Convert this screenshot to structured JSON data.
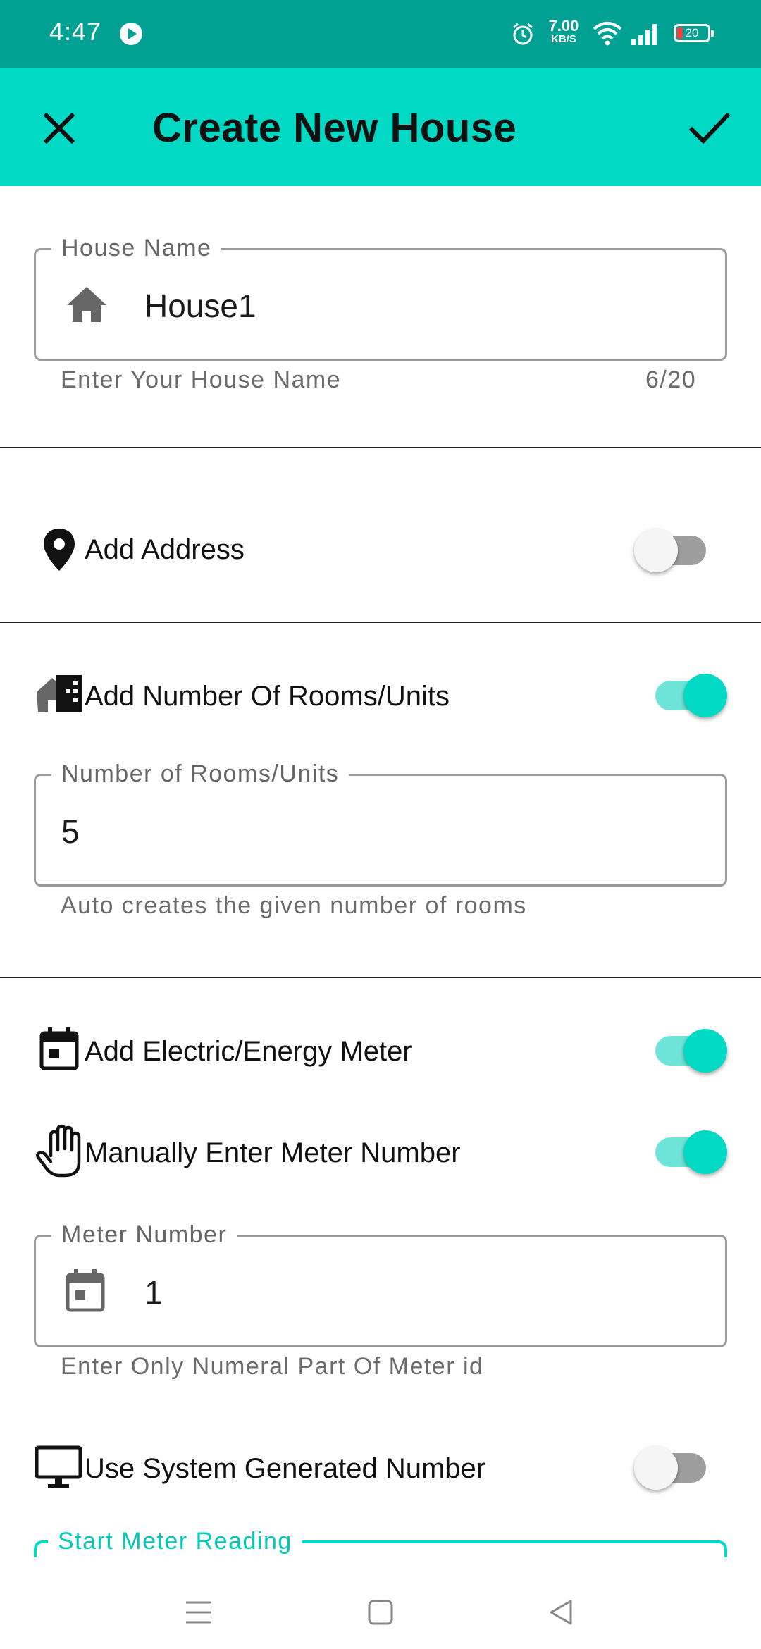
{
  "status_bar": {
    "time": "4:47",
    "speed_value": "7.00",
    "speed_unit": "KB/S",
    "battery": "20"
  },
  "app_bar": {
    "title": "Create New House",
    "close_icon": "close-icon",
    "confirm_icon": "check-icon"
  },
  "house_name": {
    "label": "House Name",
    "value": "House1",
    "helper": "Enter Your House Name",
    "counter": "6/20",
    "icon": "home-icon"
  },
  "address": {
    "label": "Add Address",
    "icon": "location-pin-icon",
    "enabled": false
  },
  "rooms": {
    "label": "Add Number Of Rooms/Units",
    "icon": "building-icon",
    "enabled": true,
    "field_label": "Number of Rooms/Units",
    "field_value": "5",
    "helper": "Auto creates the given number of rooms"
  },
  "meter": {
    "label": "Add Electric/Energy Meter",
    "icon": "calendar-icon",
    "enabled": true,
    "manual_label": "Manually Enter Meter Number",
    "manual_icon": "hand-icon",
    "manual_enabled": true,
    "field_label": "Meter Number",
    "field_value": "1",
    "field_icon": "calendar-icon",
    "helper": "Enter Only Numeral Part Of Meter id",
    "system_label": "Use System Generated Number",
    "system_icon": "monitor-icon",
    "system_enabled": false,
    "start_reading_label": "Start Meter Reading"
  },
  "colors": {
    "status_bar": "#00a193",
    "app_bar": "#02d9c4",
    "accent": "#02d9c4"
  }
}
